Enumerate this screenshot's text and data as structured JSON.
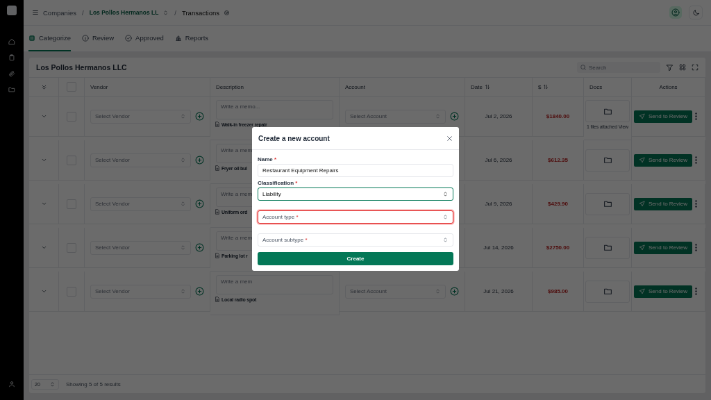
{
  "header": {
    "breadcrumbs": [
      {
        "label": "Companies",
        "kind": "plain"
      },
      {
        "separator": "/",
        "label": "Los Pollos Hermanos LL",
        "kind": "switcher"
      },
      {
        "separator": "/",
        "label": "Transactions",
        "kind": "current"
      }
    ]
  },
  "tabs": [
    {
      "label": "Categorize",
      "selected": true
    },
    {
      "label": "Review",
      "selected": false
    },
    {
      "label": "Approved",
      "selected": false
    },
    {
      "label": "Reports",
      "selected": false
    }
  ],
  "table": {
    "title": "Los Pollos Hermanos LLC",
    "search": {
      "placeholder": "Search"
    },
    "all_checked": false,
    "columns": [
      {
        "label": "Vendor",
        "sortable": false
      },
      {
        "label": "Description",
        "sortable": false
      },
      {
        "label": "Account",
        "sortable": false
      },
      {
        "label": "Date",
        "sortable": true
      },
      {
        "label": "$",
        "sortable": true
      },
      {
        "label": "Docs",
        "sortable": false
      },
      {
        "label": "Actions",
        "sortable": false
      }
    ],
    "rows": [
      {
        "checked": false,
        "vendor": "Select Vendor",
        "memo": "Write a memo...",
        "description": "Walk-in freezer repair",
        "account": "Select Account",
        "date": "Jul 2, 2026",
        "amount": "$1840.00",
        "docs_note": "1 files attached",
        "docs_link": "View",
        "action": "Send to Review"
      },
      {
        "checked": false,
        "vendor": "Select Vendor",
        "memo": "Write a mem",
        "description": "Fryer oil bul",
        "date": "Jul 6, 2026",
        "amount": "$612.35",
        "action": "Send to Review"
      },
      {
        "checked": false,
        "vendor": "Select Vendor",
        "memo": "Write a mem",
        "description": "Uniform ord",
        "date": "Jul 9, 2026",
        "amount": "$429.90",
        "action": "Send to Review"
      },
      {
        "checked": false,
        "vendor": "Select Vendor",
        "memo": "Write a mem",
        "description": "Parking lot r",
        "date": "Jul 14, 2026",
        "amount": "$2750.00",
        "action": "Send to Review"
      },
      {
        "checked": false,
        "vendor": "Select Vendor",
        "memo": "Write a mem",
        "description": "Local radio spot",
        "account": "Select Account",
        "date": "Jul 21, 2026",
        "amount": "$985.00",
        "action": "Send to Review"
      }
    ],
    "footer": {
      "page_size": "20",
      "summary": "Showing 5 of 5 results"
    }
  },
  "modal": {
    "title": "Create a new account",
    "submit": "Create",
    "fields": [
      {
        "kind": "text",
        "label": "Name",
        "required_mark": "*",
        "value": "Restaurant Equipment Repairs",
        "focused": false,
        "invalid": false
      },
      {
        "kind": "select",
        "label": "Classification",
        "required_mark": "*",
        "value": "Liability",
        "focused": true,
        "invalid": false
      },
      {
        "kind": "select",
        "placeholder": "Account type",
        "required_mark": "*",
        "focused": false,
        "invalid": true
      },
      {
        "kind": "select",
        "placeholder": "Account subtype",
        "required_mark": "*",
        "focused": false,
        "invalid": false
      }
    ]
  }
}
